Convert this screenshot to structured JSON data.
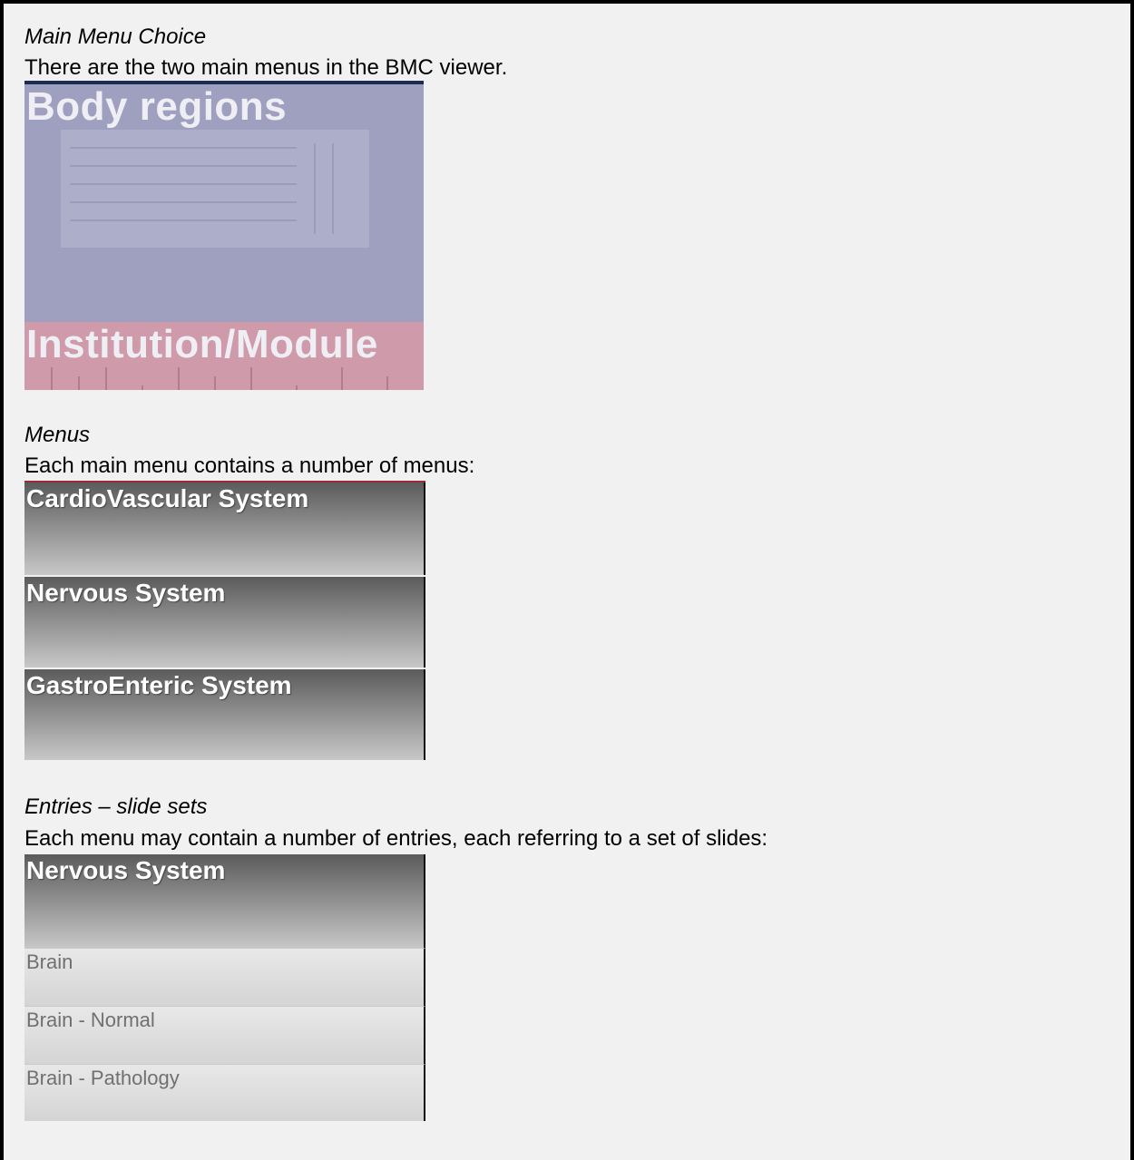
{
  "sections": {
    "main_menu_choice": {
      "heading": "Main Menu Choice",
      "description": "There are the two main menus in the BMC viewer.",
      "menus": [
        "Body regions",
        "Institution/Module"
      ]
    },
    "menus": {
      "heading": "Menus",
      "description": "Each main menu contains a number of menus:",
      "items": [
        "CardioVascular System",
        "Nervous System",
        "GastroEnteric System"
      ]
    },
    "entries": {
      "heading": "Entries – slide sets",
      "description": "Each menu may contain a number of entries, each referring to a set of slides:",
      "menu_label": "Nervous System",
      "items": [
        "Brain",
        "Brain - Normal",
        "Brain - Pathology"
      ]
    }
  },
  "colors": {
    "body_regions_panel": "#9fa0c0",
    "institution_panel": "#cf9aa9",
    "menu_bar_dark": "#5b5b5b",
    "entry_text": "#707070"
  }
}
